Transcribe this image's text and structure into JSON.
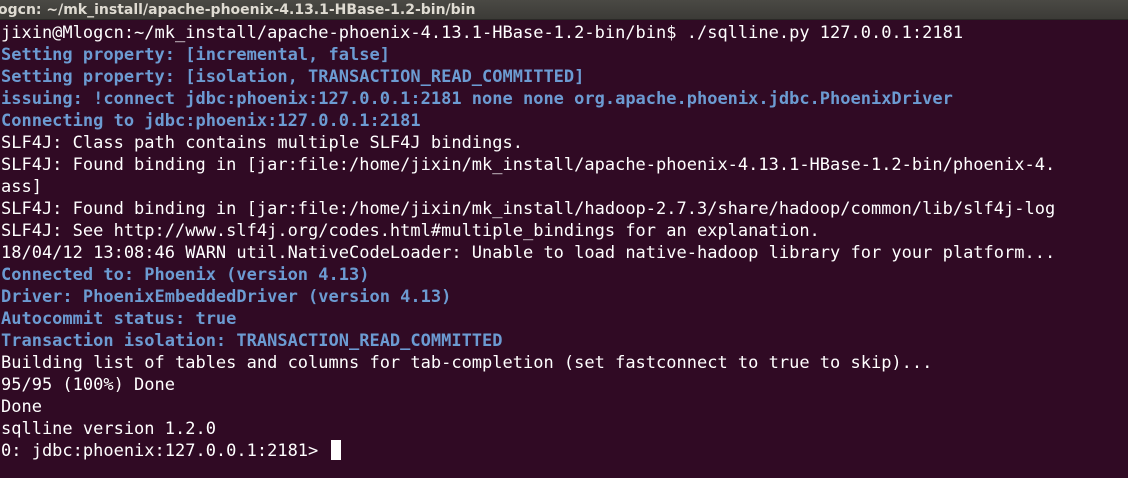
{
  "window": {
    "title": "ogcn: ~/mk_install/apache-phoenix-4.13.1-HBase-1.2-bin/bin"
  },
  "colors": {
    "background": "#300a24",
    "text": "#ffffff",
    "highlight": "#6c9bd2"
  },
  "terminal": {
    "lines": [
      {
        "text": "jixin@Mlogcn:~/mk_install/apache-phoenix-4.13.1-HBase-1.2-bin/bin$ ./sqlline.py 127.0.0.1:2181",
        "style": "normal"
      },
      {
        "text": "Setting property: [incremental, false]",
        "style": "info"
      },
      {
        "text": "Setting property: [isolation, TRANSACTION_READ_COMMITTED]",
        "style": "info"
      },
      {
        "text": "issuing: !connect jdbc:phoenix:127.0.0.1:2181 none none org.apache.phoenix.jdbc.PhoenixDriver",
        "style": "info"
      },
      {
        "text": "Connecting to jdbc:phoenix:127.0.0.1:2181",
        "style": "info"
      },
      {
        "text": "SLF4J: Class path contains multiple SLF4J bindings.",
        "style": "normal"
      },
      {
        "text": "SLF4J: Found binding in [jar:file:/home/jixin/mk_install/apache-phoenix-4.13.1-HBase-1.2-bin/phoenix-4.",
        "style": "normal"
      },
      {
        "text": "ass]",
        "style": "normal"
      },
      {
        "text": "SLF4J: Found binding in [jar:file:/home/jixin/mk_install/hadoop-2.7.3/share/hadoop/common/lib/slf4j-log",
        "style": "normal"
      },
      {
        "text": "SLF4J: See http://www.slf4j.org/codes.html#multiple_bindings for an explanation.",
        "style": "normal"
      },
      {
        "text": "18/04/12 13:08:46 WARN util.NativeCodeLoader: Unable to load native-hadoop library for your platform...",
        "style": "normal"
      },
      {
        "text": "Connected to: Phoenix (version 4.13)",
        "style": "info"
      },
      {
        "text": "Driver: PhoenixEmbeddedDriver (version 4.13)",
        "style": "info"
      },
      {
        "text": "Autocommit status: true",
        "style": "info"
      },
      {
        "text": "Transaction isolation: TRANSACTION_READ_COMMITTED",
        "style": "info"
      },
      {
        "text": "Building list of tables and columns for tab-completion (set fastconnect to true to skip)...",
        "style": "normal"
      },
      {
        "text": "95/95 (100%) Done",
        "style": "normal"
      },
      {
        "text": "Done",
        "style": "normal"
      },
      {
        "text": "sqlline version 1.2.0",
        "style": "normal"
      }
    ],
    "prompt": "0: jdbc:phoenix:127.0.0.1:2181> "
  }
}
